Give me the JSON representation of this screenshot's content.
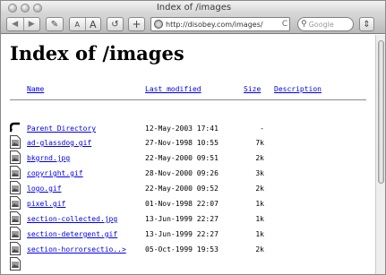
{
  "window": {
    "title": "Index of /images"
  },
  "toolbar": {
    "back_label": "◀",
    "forward_label": "▶",
    "edit_label": "✎",
    "text_smaller_label": "A",
    "text_larger_label": "A",
    "reload_label": "↺",
    "add_bookmark_label": "+",
    "url": "http://disobey.com/images/",
    "url_reload": "C",
    "search_placeholder": "Google",
    "search_icon": "⚲",
    "menu_label": "⇕"
  },
  "page": {
    "heading": "Index of /images",
    "columns": {
      "name": "Name",
      "last_modified": "Last modified",
      "size": "Size",
      "description": "Description"
    },
    "rows": [
      {
        "name": "Parent Directory",
        "date": "12-May-2003 17:41",
        "size": "-",
        "icon": "parent-directory-icon"
      },
      {
        "name": "ad-glassdog.gif",
        "date": "27-Nov-1998 10:55",
        "size": "7k",
        "icon": "image-file-icon"
      },
      {
        "name": "bkgrnd.jpg",
        "date": "22-May-2000 09:51",
        "size": "2k",
        "icon": "image-file-icon"
      },
      {
        "name": "copyright.gif",
        "date": "28-Nov-2000 09:26",
        "size": "3k",
        "icon": "image-file-icon"
      },
      {
        "name": "logo.gif",
        "date": "22-May-2000 09:52",
        "size": "2k",
        "icon": "image-file-icon"
      },
      {
        "name": "pixel.gif",
        "date": "01-Nov-1998 22:07",
        "size": "1k",
        "icon": "image-file-icon"
      },
      {
        "name": "section-collected.jpg",
        "date": "13-Jun-1999 22:27",
        "size": "1k",
        "icon": "image-file-icon"
      },
      {
        "name": "section-detergent.gif",
        "date": "13-Jun-1999 22:27",
        "size": "1k",
        "icon": "image-file-icon"
      },
      {
        "name": "section-horrorsectio..>",
        "date": "05-Oct-1999 19:53",
        "size": "2k",
        "icon": "image-file-icon"
      },
      {
        "name": "",
        "date": "",
        "size": "",
        "icon": "image-file-icon"
      }
    ]
  }
}
